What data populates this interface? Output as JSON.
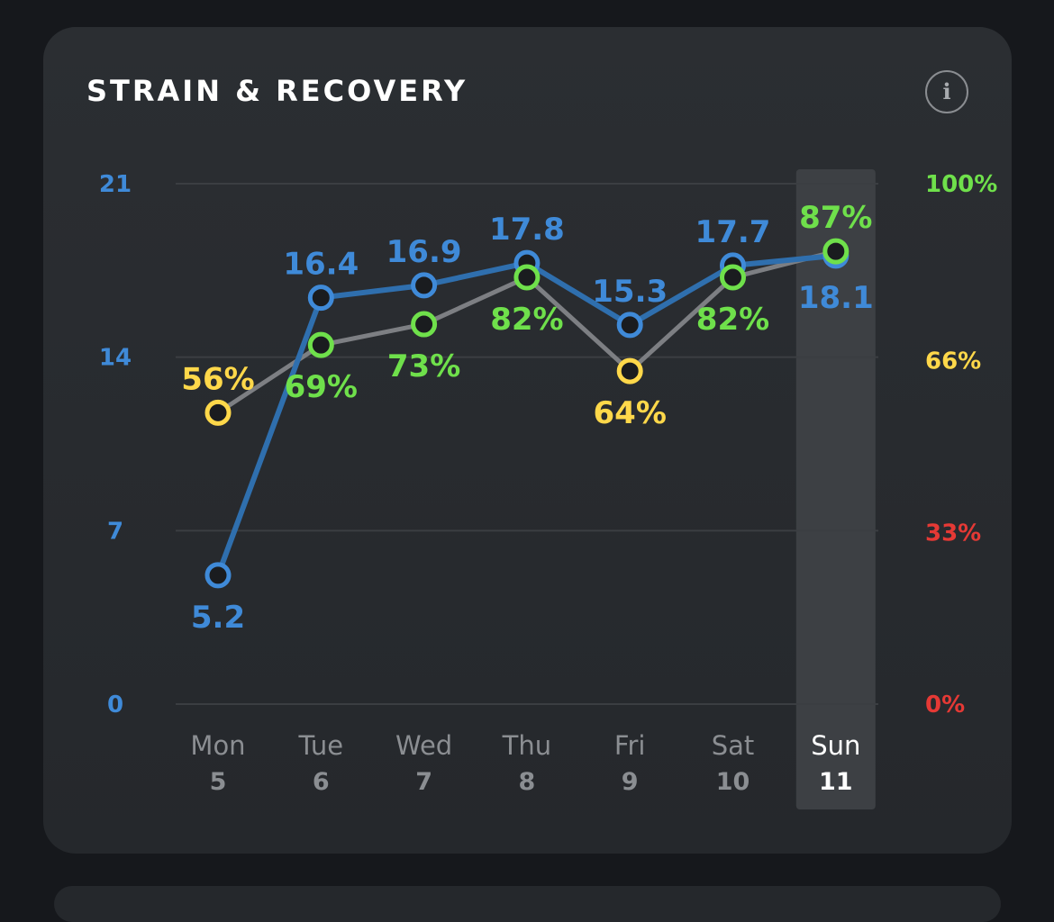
{
  "card": {
    "title": "STRAIN & RECOVERY",
    "info_icon": "info-icon",
    "info_glyph": "i"
  },
  "colors": {
    "strain": "#3f8ad8",
    "strain_line": "#2f6fae",
    "recovery_line": "#7d7f83",
    "green": "#6fe04b",
    "yellow": "#ffd84a",
    "red": "#e53935",
    "grid": "#3b3e42",
    "selected_day_bg": "#3d4044",
    "selected_day_text": "#ffffff",
    "day_text": "#8b8e92"
  },
  "chart_data": {
    "type": "line",
    "title": "",
    "categories": [
      "Mon 5",
      "Tue 6",
      "Wed 7",
      "Thu 8",
      "Fri 9",
      "Sat 10",
      "Sun 11"
    ],
    "day_names": [
      "Mon",
      "Tue",
      "Wed",
      "Thu",
      "Fri",
      "Sat",
      "Sun"
    ],
    "day_numbers": [
      "5",
      "6",
      "7",
      "8",
      "9",
      "10",
      "11"
    ],
    "selected_index": 6,
    "left_axis": {
      "ylim": [
        0,
        21
      ],
      "ticks": [
        {
          "value": 21,
          "label": "21"
        },
        {
          "value": 14,
          "label": "14"
        },
        {
          "value": 7,
          "label": "7"
        },
        {
          "value": 0,
          "label": "0"
        }
      ]
    },
    "right_axis": {
      "ylim": [
        0,
        100
      ],
      "ticks": [
        {
          "value": 100,
          "label": "100%",
          "color": "#6fe04b"
        },
        {
          "value": 66,
          "label": "66%",
          "color": "#ffd84a"
        },
        {
          "value": 33,
          "label": "33%",
          "color": "#e53935"
        },
        {
          "value": 0,
          "label": "0%",
          "color": "#e53935"
        }
      ]
    },
    "grid": true,
    "series": [
      {
        "axis": "left",
        "values": [
          5.2,
          16.4,
          16.9,
          17.8,
          15.3,
          17.7,
          18.1
        ],
        "labels": [
          "5.2",
          "16.4",
          "16.9",
          "17.8",
          "15.3",
          "17.7",
          "18.1"
        ]
      },
      {
        "axis": "right",
        "values": [
          56,
          69,
          73,
          82,
          64,
          82,
          87
        ],
        "labels": [
          "56%",
          "69%",
          "73%",
          "82%",
          "64%",
          "82%",
          "87%"
        ],
        "point_colors": [
          "#ffd84a",
          "#6fe04b",
          "#6fe04b",
          "#6fe04b",
          "#ffd84a",
          "#6fe04b",
          "#6fe04b"
        ]
      }
    ]
  }
}
